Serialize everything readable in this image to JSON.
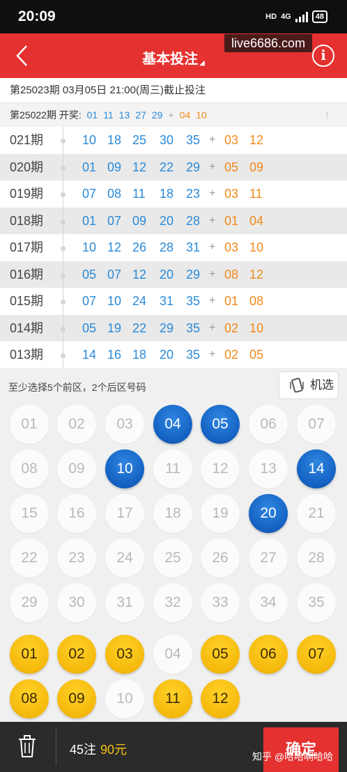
{
  "status_bar": {
    "time": "20:09",
    "network": "4G",
    "battery": "48"
  },
  "nav": {
    "title": "基本投注",
    "watermark": "live6686.com",
    "info_label": "i"
  },
  "deadline_text": "第25023期  03月05日 21:00(周三)截止投注",
  "last_draw": {
    "label": "第25022期  开奖:",
    "front": [
      "01",
      "11",
      "13",
      "27",
      "29"
    ],
    "plus": "+",
    "back": [
      "04",
      "10"
    ]
  },
  "history": [
    {
      "period": "021期",
      "front": [
        "10",
        "18",
        "25",
        "30",
        "35"
      ],
      "back": [
        "03",
        "12"
      ]
    },
    {
      "period": "020期",
      "front": [
        "01",
        "09",
        "12",
        "22",
        "29"
      ],
      "back": [
        "05",
        "09"
      ]
    },
    {
      "period": "019期",
      "front": [
        "07",
        "08",
        "11",
        "18",
        "23"
      ],
      "back": [
        "03",
        "11"
      ]
    },
    {
      "period": "018期",
      "front": [
        "01",
        "07",
        "09",
        "20",
        "28"
      ],
      "back": [
        "01",
        "04"
      ]
    },
    {
      "period": "017期",
      "front": [
        "10",
        "12",
        "26",
        "28",
        "31"
      ],
      "back": [
        "03",
        "10"
      ]
    },
    {
      "period": "016期",
      "front": [
        "05",
        "07",
        "12",
        "20",
        "29"
      ],
      "back": [
        "08",
        "12"
      ]
    },
    {
      "period": "015期",
      "front": [
        "07",
        "10",
        "24",
        "31",
        "35"
      ],
      "back": [
        "01",
        "08"
      ]
    },
    {
      "period": "014期",
      "front": [
        "05",
        "19",
        "22",
        "29",
        "35"
      ],
      "back": [
        "02",
        "10"
      ]
    },
    {
      "period": "013期",
      "front": [
        "14",
        "16",
        "18",
        "20",
        "35"
      ],
      "back": [
        "02",
        "05"
      ]
    }
  ],
  "pick": {
    "hint": "至少选择5个前区，2个后区号码",
    "random_label": "机选",
    "front_numbers": [
      "01",
      "02",
      "03",
      "04",
      "05",
      "06",
      "07",
      "08",
      "09",
      "10",
      "11",
      "12",
      "13",
      "14",
      "15",
      "16",
      "17",
      "18",
      "19",
      "20",
      "21",
      "22",
      "23",
      "24",
      "25",
      "26",
      "27",
      "28",
      "29",
      "30",
      "31",
      "32",
      "33",
      "34",
      "35"
    ],
    "front_selected": [
      "04",
      "05",
      "10",
      "14",
      "20"
    ],
    "back_numbers": [
      "01",
      "02",
      "03",
      "04",
      "05",
      "06",
      "07",
      "08",
      "09",
      "10",
      "11",
      "12"
    ],
    "back_selected": [
      "01",
      "02",
      "03",
      "05",
      "06",
      "07",
      "08",
      "09",
      "11",
      "12"
    ]
  },
  "bottom": {
    "bets": "45注",
    "amount": "90元",
    "confirm_label": "确定",
    "credit": "知乎 @哈哈啊哈哈"
  },
  "colors": {
    "red": "#e5312f",
    "blue": "#1563c4",
    "yellow": "#f5b90c",
    "front_text": "#2a8ad8",
    "back_text": "#f08a1c"
  }
}
